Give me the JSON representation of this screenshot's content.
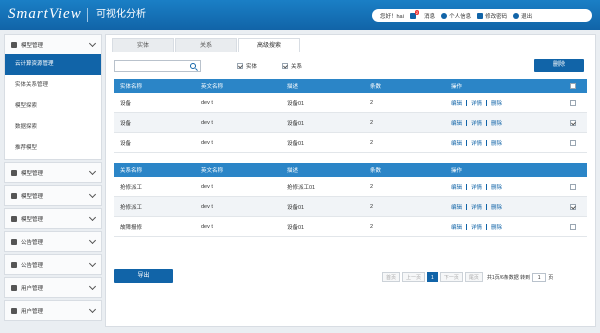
{
  "header": {
    "logo": "SmartView",
    "app_name": "可视化分析",
    "greeting": "您好！hai",
    "messages_label": "消息",
    "messages_count": "2",
    "profile_label": "个人信息",
    "password_label": "修改密码",
    "logout_label": "退出"
  },
  "sidebar": {
    "groups": [
      {
        "label": "模型管理",
        "items": [
          "云计算资源管理",
          "实体关系管理",
          "模型探索",
          "数据探索",
          "推荐模型"
        ],
        "active_item": 0
      },
      {
        "label": "模型管理"
      },
      {
        "label": "模型管理"
      },
      {
        "label": "模型管理"
      },
      {
        "label": "公告管理"
      },
      {
        "label": "公告管理"
      },
      {
        "label": "用户管理"
      },
      {
        "label": "用户管理"
      }
    ]
  },
  "tabs": [
    "实体",
    "关系",
    "高级搜索"
  ],
  "active_tab": 2,
  "search": {
    "placeholder": "",
    "value": ""
  },
  "filters": {
    "entity": "实体",
    "entity_checked": true,
    "relation": "关系",
    "relation_checked": true
  },
  "delete_button": "删除",
  "entity_table": {
    "headers": [
      "实体名称",
      "英文名称",
      "描述",
      "条数",
      "操作"
    ],
    "rows": [
      {
        "name": "设备",
        "en": "dev  t",
        "desc": "设备01",
        "count": "2",
        "checked": false
      },
      {
        "name": "设备",
        "en": "dev  t",
        "desc": "设备01",
        "count": "2",
        "checked": true
      },
      {
        "name": "设备",
        "en": "dev  t",
        "desc": "设备01",
        "count": "2",
        "checked": false
      }
    ]
  },
  "relation_table": {
    "headers": [
      "关系名称",
      "英文名称",
      "描述",
      "条数",
      "操作"
    ],
    "rows": [
      {
        "name": "抢修派工",
        "en": "dev  t",
        "desc": "抢修派工01",
        "count": "2",
        "checked": false
      },
      {
        "name": "抢修派工",
        "en": "dev  t",
        "desc": "设备01",
        "count": "2",
        "checked": true
      },
      {
        "name": "故障报修",
        "en": "dev  t",
        "desc": "设备01",
        "count": "2",
        "checked": false
      }
    ]
  },
  "row_actions": {
    "edit": "编辑",
    "detail": "详情",
    "delete": "删除"
  },
  "export_button": "导出",
  "pagination": {
    "first": "首页",
    "prev": "上一页",
    "current": "1",
    "next": "下一页",
    "last": "尾页",
    "info": "共1页/6条数据 转到",
    "goto_value": "1",
    "page_unit": "页"
  }
}
